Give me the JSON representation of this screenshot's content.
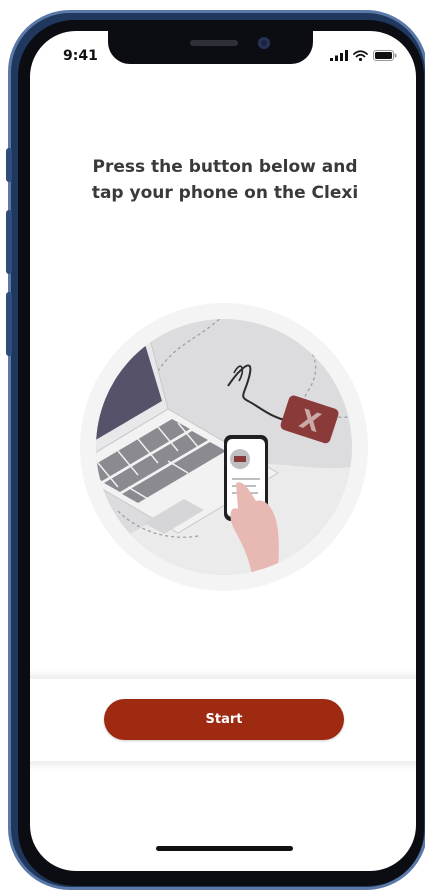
{
  "status_bar": {
    "time": "9:41",
    "icons": [
      "cellular-signal-icon",
      "wifi-icon",
      "battery-icon"
    ]
  },
  "instructions": {
    "headline": "Press the button below and\ntap your phone on the Clexi"
  },
  "illustration": {
    "name": "laptop-phone-tap-illustration",
    "badge_letter": "X"
  },
  "actions": {
    "start_label": "Start"
  },
  "colors": {
    "accent": "#9e2a12",
    "device_red": "#8a3a38",
    "hand": "#e8b8b3",
    "laptop_screen": "#56526a",
    "frame": "#20385e"
  }
}
